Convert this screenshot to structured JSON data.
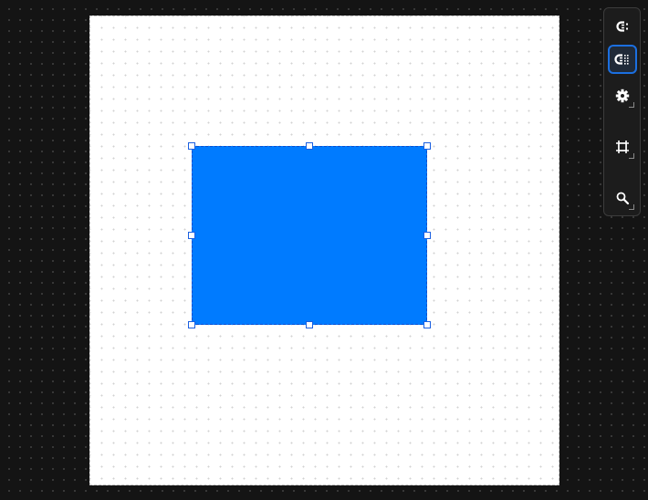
{
  "canvas": {
    "background": "#141414",
    "artboard_color": "#ffffff"
  },
  "selected_shape": {
    "type": "rectangle",
    "fill": "#007bff",
    "selected": true
  },
  "toolbar": {
    "tools": [
      {
        "name": "snap-icon",
        "active": false
      },
      {
        "name": "snap-to-grid-icon",
        "active": true
      },
      {
        "name": "gear-icon",
        "active": false,
        "has_submenu": true
      },
      {
        "name": "crop-frame-icon",
        "active": false,
        "has_submenu": true
      },
      {
        "name": "search-icon",
        "active": false,
        "has_submenu": true
      }
    ],
    "accent": "#1b6fe0"
  }
}
